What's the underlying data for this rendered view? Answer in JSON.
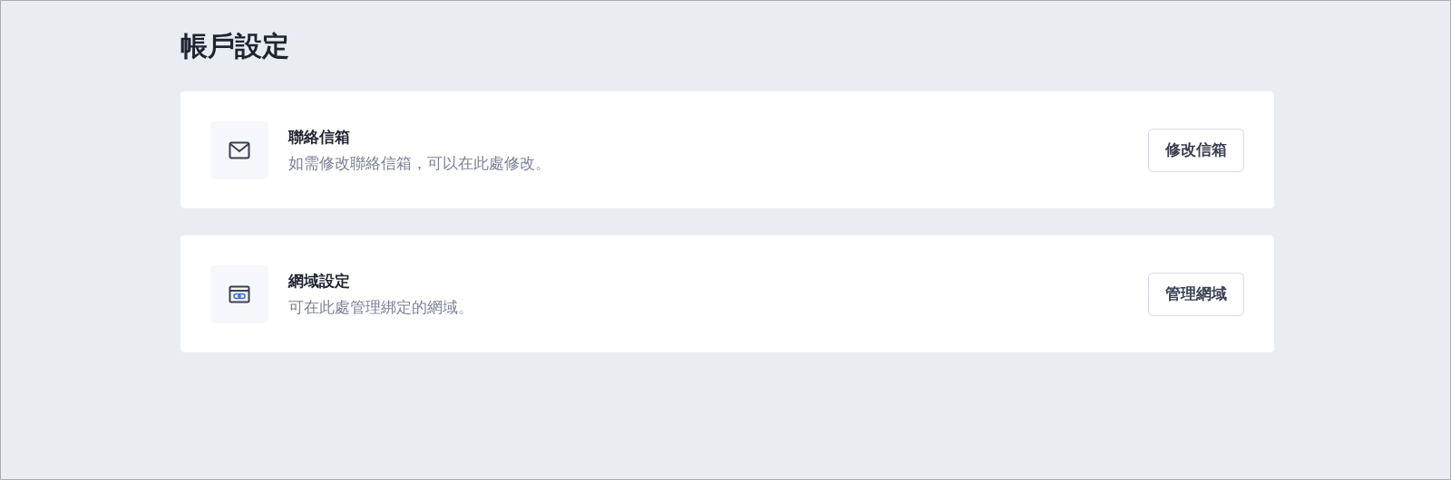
{
  "title": "帳戶設定",
  "sections": [
    {
      "kind": "mail",
      "heading": "聯絡信箱",
      "description": "如需修改聯絡信箱，可以在此處修改。",
      "button": "修改信箱"
    },
    {
      "kind": "domain",
      "heading": "網域設定",
      "description": "可在此處管理綁定的網域。",
      "button": "管理網域"
    }
  ]
}
